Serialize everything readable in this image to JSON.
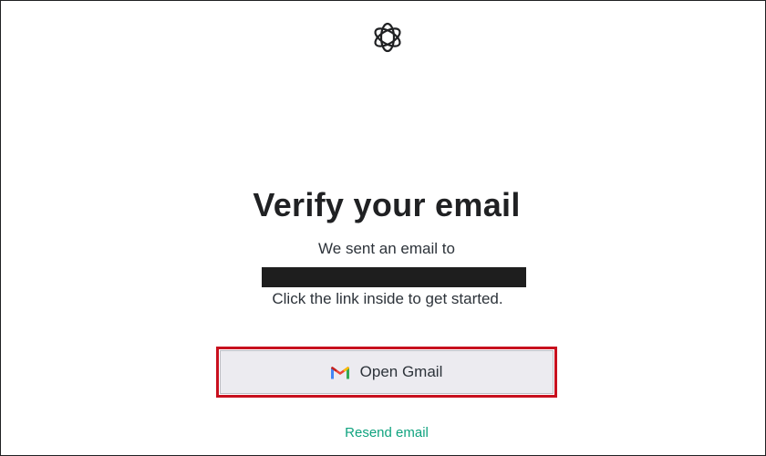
{
  "header": {
    "logo_icon": "openai-logo-icon"
  },
  "main": {
    "title": "Verify your email",
    "sent_text": "We sent an email to",
    "email_redacted": true,
    "instruction": "Click the link inside to get started."
  },
  "actions": {
    "open_gmail_label": "Open Gmail",
    "gmail_icon": "gmail-icon",
    "resend_label": "Resend email"
  },
  "colors": {
    "title": "#202123",
    "text": "#2d333a",
    "button_bg": "#ecebf0",
    "highlight_border": "#c8101e",
    "link": "#10a37f"
  }
}
